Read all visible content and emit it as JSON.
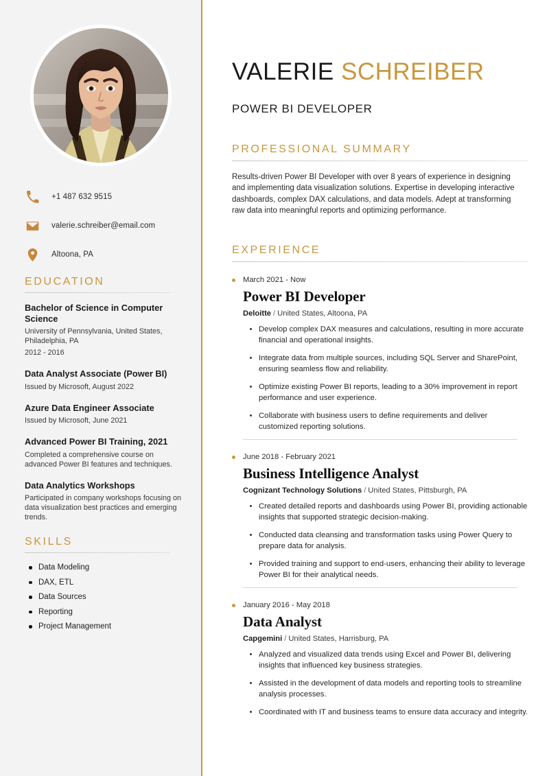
{
  "accent_color": "#c8973f",
  "sidebar": {
    "photo": {
      "icon": "profile-photo",
      "alt": "Portrait of Valerie Schreiber"
    },
    "contact": [
      {
        "icon": "phone-icon",
        "value": "+1 487 632 9515"
      },
      {
        "icon": "email-icon",
        "value": "valerie.schreiber@email.com"
      },
      {
        "icon": "location-pin-icon",
        "value": "Altoona, PA"
      }
    ],
    "education": {
      "heading": "EDUCATION",
      "items": [
        {
          "title": "Bachelor of Science in Computer Science",
          "subtitle": "University of Pennsylvania, United States, Philadelphia, PA",
          "date": "2012 - 2016"
        },
        {
          "title": "Data Analyst Associate (Power BI)",
          "subtitle": "Issued by Microsoft, August 2022",
          "date": ""
        },
        {
          "title": "Azure Data Engineer Associate",
          "subtitle": "Issued by Microsoft, June 2021",
          "date": ""
        },
        {
          "title": "Advanced Power BI Training, 2021",
          "subtitle": "Completed a comprehensive course on advanced Power BI features and techniques.",
          "date": ""
        },
        {
          "title": "Data Analytics Workshops",
          "subtitle": "Participated in company workshops focusing on data visualization best practices and emerging trends.",
          "date": ""
        }
      ]
    },
    "skills": {
      "heading": "SKILLS",
      "items": [
        "Data Modeling",
        "DAX, ETL",
        "Data Sources",
        "Reporting",
        "Project Management"
      ]
    }
  },
  "main": {
    "name_first": "VALERIE",
    "name_last": "SCHREIBER",
    "role": "POWER BI DEVELOPER",
    "summary": {
      "heading": "PROFESSIONAL SUMMARY",
      "text": "Results-driven Power BI Developer with over 8 years of experience in designing and implementing data visualization solutions. Expertise in developing interactive dashboards, complex DAX calculations, and data models. Adept at transforming raw data into meaningful reports and optimizing performance."
    },
    "experience": {
      "heading": "EXPERIENCE",
      "items": [
        {
          "date": "March 2021 - Now",
          "title": "Power BI Developer",
          "company": "Deloitte",
          "separator": "/",
          "location": "United States, Altoona, PA",
          "bullets": [
            "Develop complex DAX measures and calculations, resulting in more accurate financial and operational insights.",
            "Integrate data from multiple sources, including SQL Server and SharePoint, ensuring seamless flow and reliability.",
            "Optimize existing Power BI reports, leading to a 30% improvement in report performance and user experience.",
            "Collaborate with business users to define requirements and deliver customized reporting solutions."
          ]
        },
        {
          "date": "June 2018 - February 2021",
          "title": "Business Intelligence Analyst",
          "company": "Cognizant Technology Solutions",
          "separator": "/",
          "location": "United States, Pittsburgh, PA",
          "bullets": [
            "Created detailed reports and dashboards using Power BI, providing actionable insights that supported strategic decision-making.",
            "Conducted data cleansing and transformation tasks using Power Query to prepare data for analysis.",
            "Provided training and support to end-users, enhancing their ability to leverage Power BI for their analytical needs."
          ]
        },
        {
          "date": "January 2016 - May 2018",
          "title": "Data Analyst",
          "company": "Capgemini",
          "separator": "/",
          "location": "United States, Harrisburg, PA",
          "bullets": [
            "Analyzed and visualized data trends using Excel and Power BI, delivering insights that influenced key business strategies.",
            "Assisted in the development of data models and reporting tools to streamline analysis processes.",
            "Coordinated with IT and business teams to ensure data accuracy and integrity."
          ]
        }
      ]
    }
  }
}
